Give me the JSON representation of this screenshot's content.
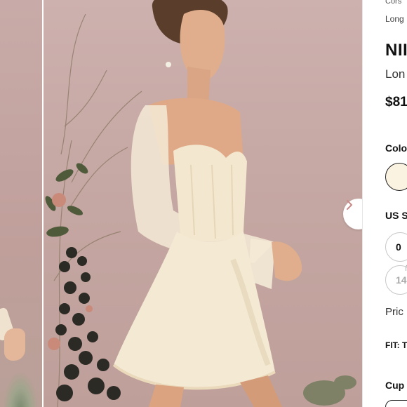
{
  "gallery": {
    "next_button_label": "Next image",
    "icons": {
      "next": "chevron-right-icon"
    },
    "colors": {
      "backdrop": "#c5a7a3",
      "dress": "#f2e6cf",
      "chevron": "#c98a8a"
    }
  },
  "product": {
    "breadcrumb": "Cors",
    "subtitle_small": "Long",
    "title": "NII",
    "subtitle": "Lon",
    "price": "$81",
    "colour_label": "Colo",
    "swatch_color": "#fbf3e2",
    "size_label": "US S",
    "sizes": [
      {
        "label": "0",
        "available": true
      },
      {
        "label": "14",
        "available": false
      }
    ],
    "pricing_note": "Pric",
    "fit_label": "FIT: T",
    "cup_label": "Cup"
  }
}
